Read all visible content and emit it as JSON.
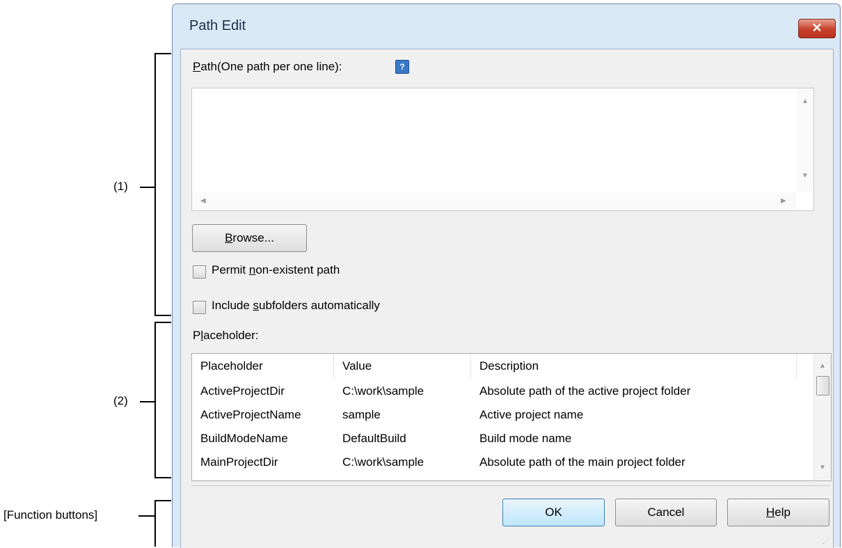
{
  "dialog": {
    "title": "Path Edit",
    "close_glyph": "✕",
    "path_label_underlined": "P",
    "path_label_rest": "ath(One path per one line):",
    "path_value": "",
    "browse_underlined": "B",
    "browse_rest": "rowse...",
    "permit_before": "Permit ",
    "permit_underlined": "n",
    "permit_after": "on-existent path",
    "permit_checked": false,
    "include_before": "Include ",
    "include_underlined": "s",
    "include_after": "ubfolders automatically",
    "include_checked": false,
    "placeholder_label_before": "P",
    "placeholder_label_underlined": "l",
    "placeholder_label_after": "aceholder:",
    "table": {
      "headers": [
        "Placeholder",
        "Value",
        "Description"
      ],
      "rows": [
        [
          "ActiveProjectDir",
          "C:\\work\\sample",
          "Absolute path of the active project folder"
        ],
        [
          "ActiveProjectName",
          "sample",
          "Active project name"
        ],
        [
          "BuildModeName",
          "DefaultBuild",
          "Build mode name"
        ],
        [
          "MainProjectDir",
          "C:\\work\\sample",
          "Absolute path of the main project folder"
        ]
      ]
    },
    "ok_label": "OK",
    "cancel_label": "Cancel",
    "help_underlined": "H",
    "help_rest": "elp"
  },
  "annotations": {
    "area1": "(1)",
    "area2": "(2)",
    "function_buttons": "[Function buttons]"
  },
  "icons": {
    "close": "close-icon",
    "help": "help-icon",
    "scroll_up": "scroll-up-icon",
    "scroll_down": "scroll-down-icon",
    "scroll_left": "scroll-left-icon",
    "scroll_right": "scroll-right-icon",
    "size_grip": "size-grip-icon"
  },
  "colors": {
    "title_bar": "#dbe8f6",
    "close_button": "#c7402a",
    "ok_button": "#bee6fd"
  }
}
